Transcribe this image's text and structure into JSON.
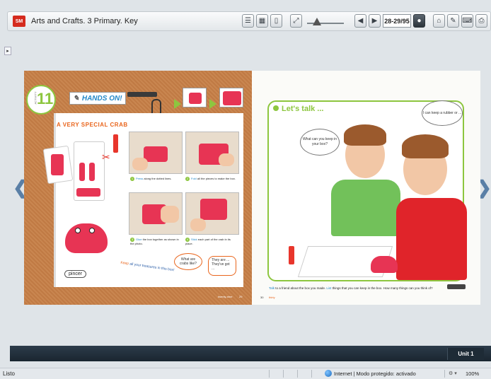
{
  "window": {
    "logo_text": "SM",
    "title": "Arts and Crafts. 3 Primary. Key"
  },
  "toolbar": {
    "page_field": "28-29/95",
    "prev_symbol": "◀",
    "next_symbol": "▶"
  },
  "book": {
    "left_page": {
      "activity_word": "ACTIVITY",
      "activity_number": "11",
      "hands_on": "HANDS ON!",
      "crab_title": "A VERY SPECIAL CRAB",
      "pincer_label": "pincer",
      "steps": [
        {
          "num": "1",
          "keyword": "Press",
          "text": "along the dotted lines."
        },
        {
          "num": "2",
          "keyword": "Fold",
          "text": "all the pieces to make the box."
        },
        {
          "num": "3",
          "keyword": "Glue",
          "text": "the box together as shown in the photo."
        },
        {
          "num": "4",
          "keyword": "Stick",
          "text": "each part of the crab in its place."
        }
      ],
      "curved_keyword": "Keep",
      "curved_text": "all your treasures in this box!",
      "bubble_what": "What are crabs like?",
      "bubble_they": "They are ... They've got ...",
      "page_word": "twenty-nine",
      "page_number": "29"
    },
    "right_page": {
      "title": "Let's talk ...",
      "bubble_left": "What can you keep in your box?",
      "bubble_right": "I can keep a rubber or ...",
      "instruction_kw1": "Talk",
      "instruction_1": "to a friend about the box you made.",
      "instruction_kw2": "List",
      "instruction_2": "things that you can keep in the box. How many things can you think of?",
      "page_number": "30",
      "page_word": "thirty"
    }
  },
  "bottom": {
    "unit_label": "Unit 1"
  },
  "statusbar": {
    "left_text": "Listo",
    "zone_text": "Internet | Modo protegido: activado",
    "zoom_text": "100%"
  },
  "colors": {
    "accent_green": "#8dc63f",
    "brand_red": "#d52b1e",
    "crab_pink": "#e73454",
    "cork": "#c98650",
    "bar_navy": "#1a2630"
  }
}
